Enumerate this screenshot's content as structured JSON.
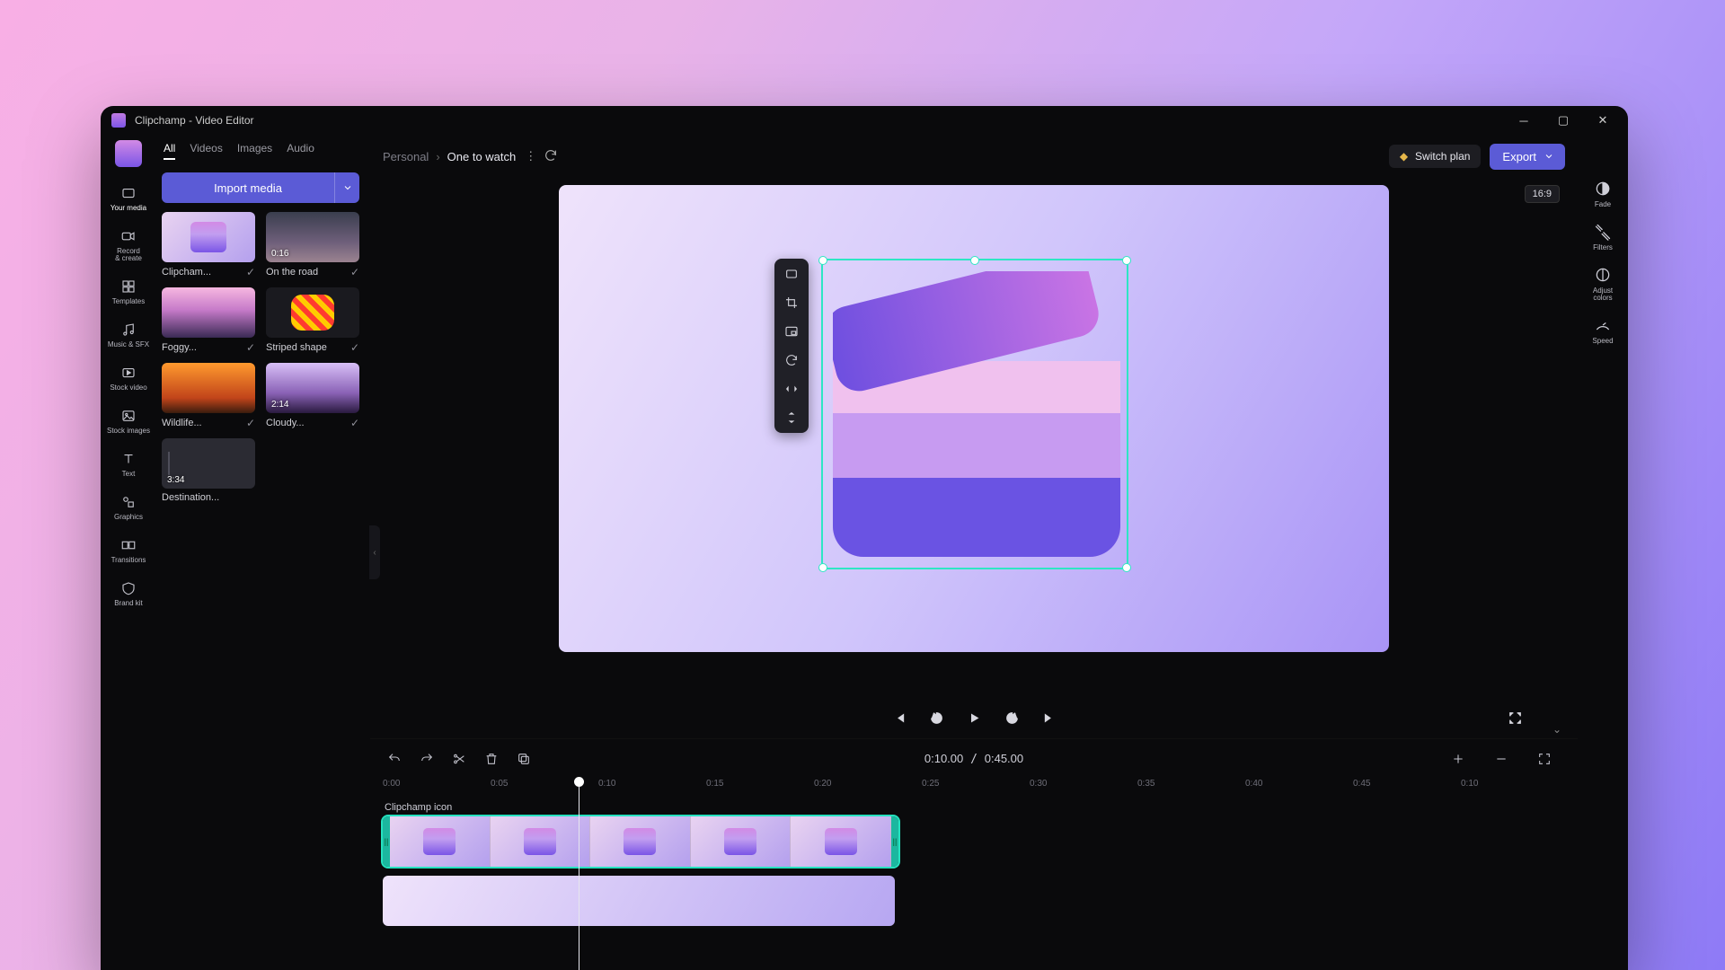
{
  "window": {
    "title": "Clipchamp - Video Editor"
  },
  "rail": [
    {
      "id": "your-media",
      "label": "Your media"
    },
    {
      "id": "record",
      "label": "Record\n& create"
    },
    {
      "id": "templates",
      "label": "Templates"
    },
    {
      "id": "music",
      "label": "Music & SFX"
    },
    {
      "id": "stock-video",
      "label": "Stock video"
    },
    {
      "id": "stock-images",
      "label": "Stock images"
    },
    {
      "id": "text",
      "label": "Text"
    },
    {
      "id": "graphics",
      "label": "Graphics"
    },
    {
      "id": "transitions",
      "label": "Transitions"
    },
    {
      "id": "brand-kit",
      "label": "Brand kit"
    }
  ],
  "media_tabs": [
    "All",
    "Videos",
    "Images",
    "Audio"
  ],
  "media_tab_active": "All",
  "import_label": "Import media",
  "media": [
    {
      "name": "Clipcham...",
      "dur": "",
      "kind": "logo"
    },
    {
      "name": "On the road",
      "dur": "0:16",
      "kind": "road"
    },
    {
      "name": "Foggy...",
      "dur": "",
      "kind": "foggy"
    },
    {
      "name": "Striped shape",
      "dur": "",
      "kind": "stripe"
    },
    {
      "name": "Wildlife...",
      "dur": "",
      "kind": "wild"
    },
    {
      "name": "Cloudy...",
      "dur": "2:14",
      "kind": "cloud"
    },
    {
      "name": "Destination...",
      "dur": "3:34",
      "kind": "audio"
    }
  ],
  "breadcrumb": {
    "root": "Personal",
    "project": "One to watch"
  },
  "switch_plan": "Switch plan",
  "export_label": "Export",
  "aspect": "16:9",
  "float_tools": [
    "fit",
    "crop",
    "pip",
    "rotate",
    "fliph",
    "flipv"
  ],
  "props": [
    {
      "id": "fade",
      "label": "Fade"
    },
    {
      "id": "filters",
      "label": "Filters"
    },
    {
      "id": "adjust",
      "label": "Adjust\ncolors"
    },
    {
      "id": "speed",
      "label": "Speed"
    }
  ],
  "playback": {
    "current": "0:10.00",
    "total": "0:45.00"
  },
  "ruler": [
    "0:00",
    "0:05",
    "0:10",
    "0:15",
    "0:20",
    "0:25",
    "0:30",
    "0:35",
    "0:40",
    "0:45",
    "0:10"
  ],
  "timeline": {
    "clip_label": "Clipchamp icon"
  },
  "colors": {
    "accent": "#5b5bd6",
    "selection": "#25e2bf"
  }
}
